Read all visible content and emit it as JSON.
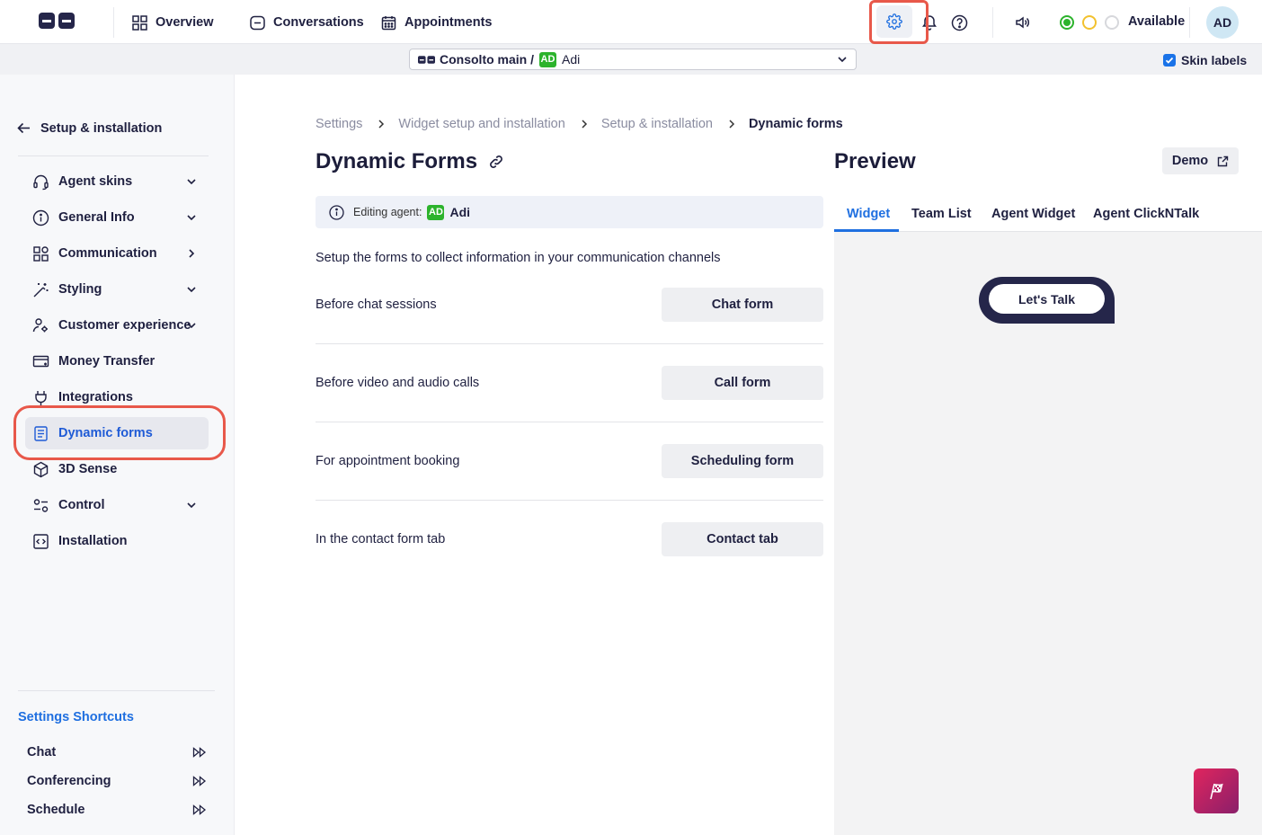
{
  "topbar": {
    "nav": [
      {
        "label": "Overview",
        "icon": "grid-icon"
      },
      {
        "label": "Conversations",
        "icon": "chat-icon"
      },
      {
        "label": "Appointments",
        "icon": "calendar-icon"
      }
    ],
    "status_label": "Available",
    "avatar_initials": "AD",
    "status_colors": {
      "online": "#2cb32c",
      "away": "#f2c12e",
      "offline": "#d7d8dc"
    }
  },
  "subbar": {
    "account_name": "Consolto main /",
    "agent_badge": "AD",
    "agent_name": "Adi",
    "skin_labels": "Skin labels",
    "skin_labels_checked": true
  },
  "sidebar": {
    "back_label": "Setup & installation",
    "items": [
      {
        "label": "Agent skins",
        "icon": "headset-icon",
        "caret": "down"
      },
      {
        "label": "General Info",
        "icon": "info-icon",
        "caret": "down"
      },
      {
        "label": "Communication",
        "icon": "apps-icon",
        "caret": "right"
      },
      {
        "label": "Styling",
        "icon": "magic-wand-icon",
        "caret": "down"
      },
      {
        "label": "Customer experience",
        "icon": "settings-user-icon",
        "caret": "down"
      },
      {
        "label": "Money Transfer",
        "icon": "card-icon",
        "caret": "none"
      },
      {
        "label": "Integrations",
        "icon": "plug-icon",
        "caret": "none"
      },
      {
        "label": "Dynamic forms",
        "icon": "form-icon",
        "caret": "none",
        "active": true
      },
      {
        "label": "3D Sense",
        "icon": "cube-icon",
        "caret": "none"
      },
      {
        "label": "Control",
        "icon": "toggle-icon",
        "caret": "down"
      },
      {
        "label": "Installation",
        "icon": "code-icon",
        "caret": "none"
      }
    ],
    "shortcuts_title": "Settings Shortcuts",
    "shortcuts": [
      "Chat",
      "Conferencing",
      "Schedule"
    ]
  },
  "main": {
    "breadcrumb": [
      "Settings",
      "Widget setup and installation",
      "Setup & installation",
      "Dynamic forms"
    ],
    "title": "Dynamic Forms",
    "editing_label": "Editing agent:",
    "editing_badge": "AD",
    "editing_agent": "Adi",
    "intro": "Setup the forms to collect information in your communication channels",
    "forms": [
      {
        "label": "Before chat sessions",
        "button": "Chat form"
      },
      {
        "label": "Before video and audio calls",
        "button": "Call form"
      },
      {
        "label": "For appointment booking",
        "button": "Scheduling form"
      },
      {
        "label": "In the contact form tab",
        "button": "Contact tab"
      }
    ]
  },
  "preview": {
    "title": "Preview",
    "demo_label": "Demo",
    "tabs": [
      "Widget",
      "Team List",
      "Agent Widget",
      "Agent ClickNTalk"
    ],
    "active_tab": "Widget",
    "widget_button": "Let's Talk"
  }
}
